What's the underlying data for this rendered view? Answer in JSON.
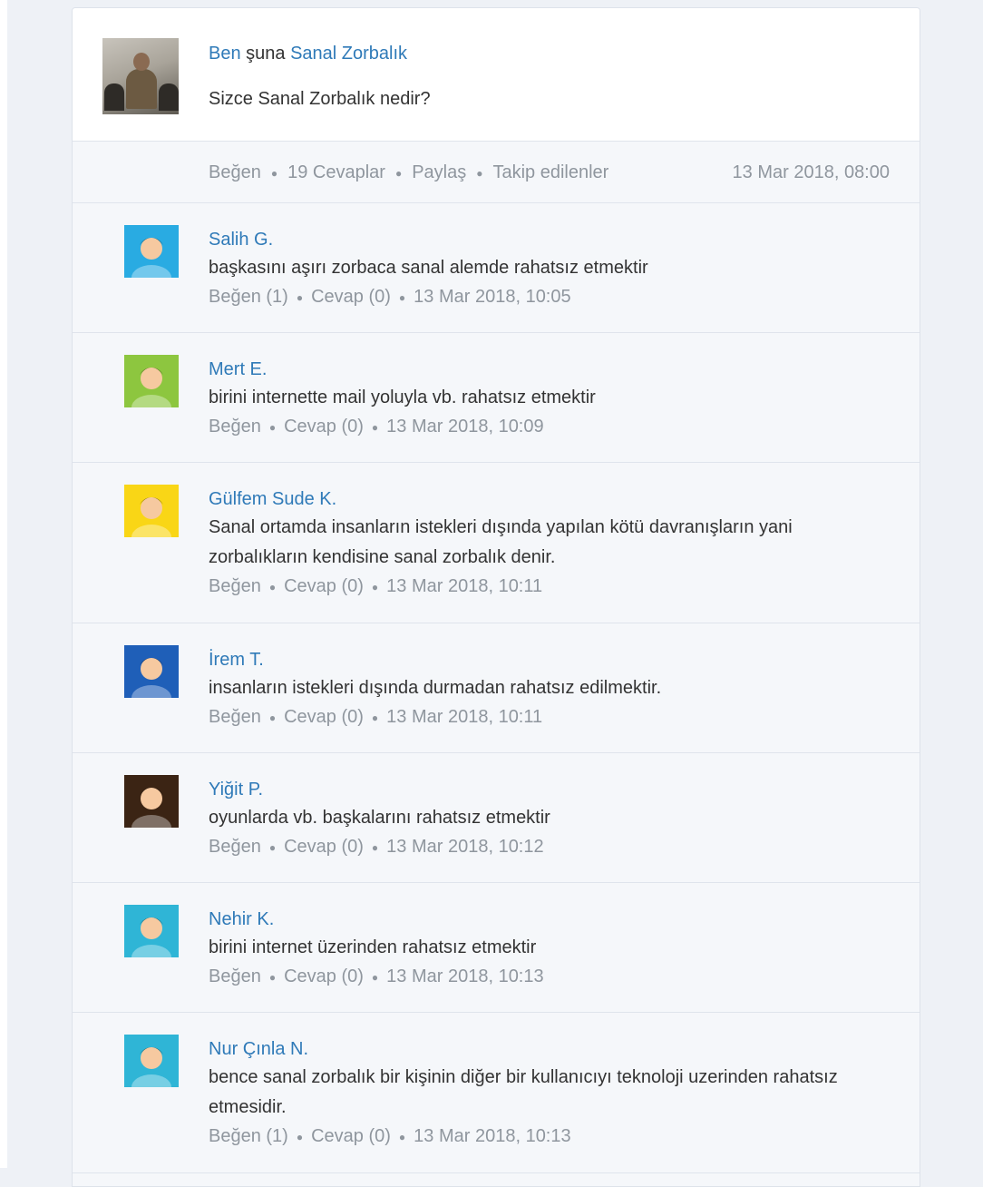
{
  "post": {
    "author": "Ben",
    "connector": "şuna",
    "topic": "Sanal Zorbalık",
    "question": "Sizce Sanal Zorbalık nedir?"
  },
  "post_meta": {
    "like": "Beğen",
    "replies": "19 Cevaplar",
    "share": "Paylaş",
    "followers": "Takip edilenler",
    "timestamp": "13 Mar 2018, 08:00"
  },
  "answers": [
    {
      "name": "Salih G.",
      "text": "başkasını aşırı zorbaca sanal alemde rahatsız etmektir",
      "like": "Beğen (1)",
      "reply": "Cevap (0)",
      "time": "13 Mar 2018, 10:05",
      "avatar": "boy-cartoon-avatar",
      "bg": "#29abe2"
    },
    {
      "name": "Mert E.",
      "text": "birini internette mail yoluyla vb. rahatsız etmektir",
      "like": "Beğen",
      "reply": "Cevap (0)",
      "time": "13 Mar 2018, 10:09",
      "avatar": "sunglasses-boy-avatar",
      "bg": "#8dc63f"
    },
    {
      "name": "Gülfem Sude K.",
      "text": "Sanal ortamda insanların istekleri dışında yapılan kötü davranışların yani zorbalıkların kendisine sanal zorbalık denir.",
      "like": "Beğen",
      "reply": "Cevap (0)",
      "time": "13 Mar 2018, 10:11",
      "avatar": "redhead-girl-avatar",
      "bg": "#f9d616"
    },
    {
      "name": "İrem T.",
      "text": "insanların istekleri dışında durmadan rahatsız edilmektir.",
      "like": "Beğen",
      "reply": "Cevap (0)",
      "time": "13 Mar 2018, 10:11",
      "avatar": "girl-glasses-avatar",
      "bg": "#1f5fb8"
    },
    {
      "name": "Yiğit P.",
      "text": "oyunlarda vb. başkalarını rahatsız etmektir",
      "like": "Beğen",
      "reply": "Cevap (0)",
      "time": "13 Mar 2018, 10:12",
      "avatar": "pirate-skull-avatar",
      "bg": "#3b2414"
    },
    {
      "name": "Nehir K.",
      "text": "birini internet üzerinden rahatsız etmektir",
      "like": "Beğen",
      "reply": "Cevap (0)",
      "time": "13 Mar 2018, 10:13",
      "avatar": "girl-bun-glasses-avatar",
      "bg": "#2fb5d6"
    },
    {
      "name": "Nur Çınla N.",
      "text": "bence sanal zorbalık bir kişinin diğer bir kullanıcıyı teknoloji uzerinden rahatsız etmesidir.",
      "like": "Beğen (1)",
      "reply": "Cevap (0)",
      "time": "13 Mar 2018, 10:13",
      "avatar": "girl-bun-avatar",
      "bg": "#2fb5d6"
    }
  ]
}
